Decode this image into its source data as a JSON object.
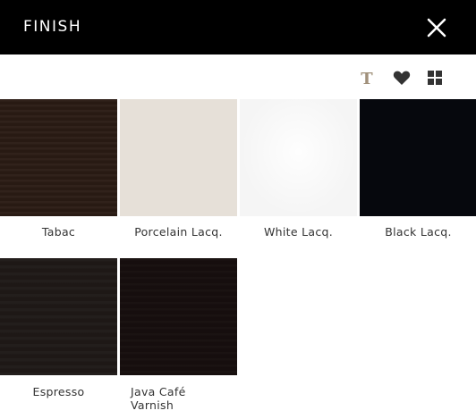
{
  "header": {
    "title": "FINISH",
    "close_icon": "close-icon",
    "background": "#000000"
  },
  "toolbar": {
    "icons": [
      "text-icon",
      "heart-icon",
      "grid-icon"
    ],
    "text_icon_glyph": "T",
    "text_icon_color": "#a0907a"
  },
  "swatches": [
    {
      "label": "Tabac",
      "color": "#2a1b14"
    },
    {
      "label": "Porcelain Lacq.",
      "color": "#e6e0d8"
    },
    {
      "label": "White Lacq.",
      "color": "#f5f5f5"
    },
    {
      "label": "Black Lacq.",
      "color": "#06080d"
    },
    {
      "label": "Espresso",
      "color": "#1f1917"
    },
    {
      "label": "Java Café Varnish",
      "label_line1": "Java Café",
      "label_line2": "Varnish",
      "color": "#170f0e"
    }
  ]
}
